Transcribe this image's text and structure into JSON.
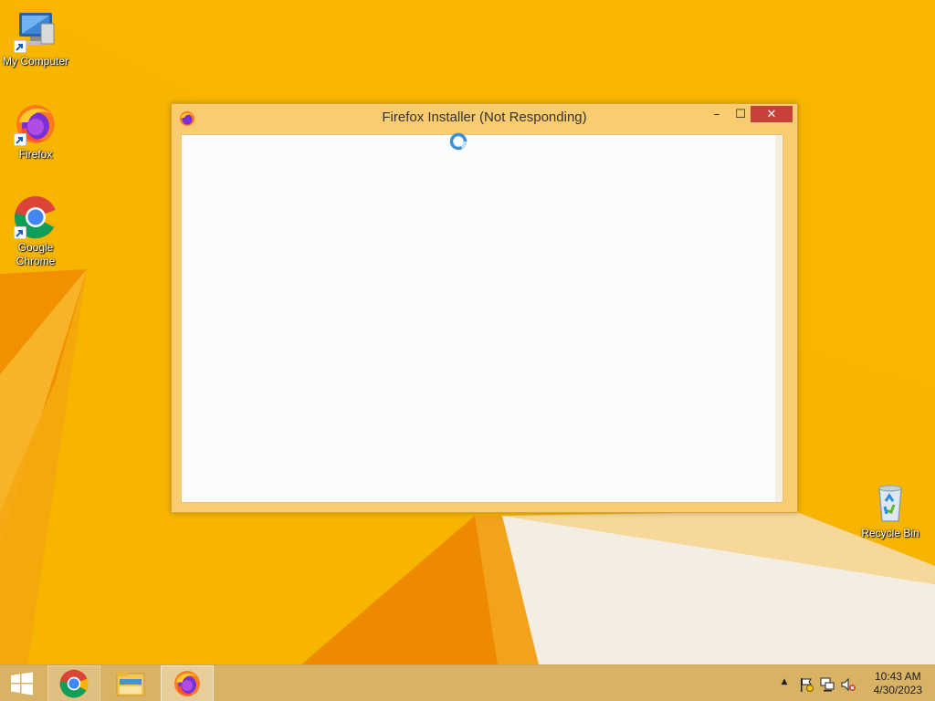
{
  "desktop": {
    "icons": [
      {
        "label": "My Computer",
        "icon": "computer-icon"
      },
      {
        "label": "Firefox",
        "icon": "firefox-icon"
      },
      {
        "label": "Google\nChrome",
        "icon": "chrome-icon"
      },
      {
        "label": "Recycle Bin",
        "icon": "recycle-bin-icon"
      }
    ]
  },
  "window": {
    "title": "Firefox Installer (Not Responding)",
    "minimize_glyph": "–",
    "maximize_glyph": "☐",
    "close_glyph": "✕",
    "state": "not-responding"
  },
  "taskbar": {
    "pinned": [
      {
        "name": "Google Chrome",
        "icon": "chrome-icon"
      },
      {
        "name": "File Explorer",
        "icon": "folder-icon"
      },
      {
        "name": "Firefox",
        "icon": "firefox-icon",
        "active": true
      }
    ],
    "tray": {
      "show_hidden_glyph": "▲",
      "icons": [
        "action-center-flag-icon",
        "network-icon",
        "volume-muted-icon"
      ]
    },
    "clock": {
      "time": "10:43 AM",
      "date": "4/30/2023"
    }
  },
  "colors": {
    "wallpaper": "#f7b500",
    "window_frame": "#f8cc6f",
    "close_button": "#c7403a",
    "taskbar": "#d6b36e",
    "busy_cursor": "#3a8fd8"
  }
}
